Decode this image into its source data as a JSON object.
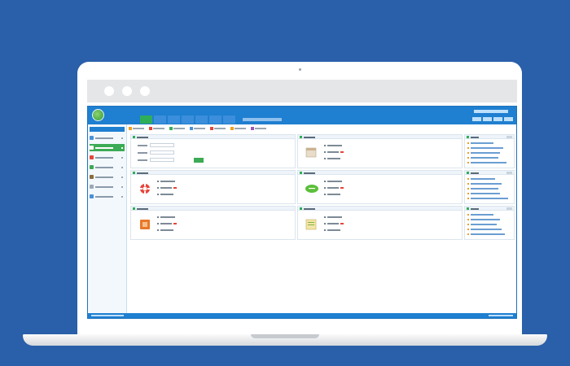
{
  "colors": {
    "background": "#2a5fa9",
    "header": "#1f7fd0",
    "active_green": "#3cab55",
    "alert_red": "#e4463a"
  },
  "app": {
    "title": "",
    "nav_tabs": [
      "",
      "",
      "",
      "",
      "",
      "",
      ""
    ],
    "active_tab_index": 0
  },
  "sidebar": {
    "heading": "",
    "items": [
      {
        "label": "",
        "icon": "home-icon"
      },
      {
        "label": "",
        "icon": "document-icon"
      },
      {
        "label": "",
        "icon": "user-icon"
      },
      {
        "label": "",
        "icon": "settings-icon"
      },
      {
        "label": "",
        "icon": "chart-icon"
      },
      {
        "label": "",
        "icon": "message-icon"
      },
      {
        "label": "",
        "icon": "grid-icon"
      }
    ],
    "active_index": 1
  },
  "dashboard": {
    "search_button": "",
    "panels": [
      {
        "title": "",
        "icon": "search-form-icon"
      },
      {
        "title": "",
        "icon": "calendar-icon"
      },
      {
        "title": "",
        "icon": "lifebuoy-icon"
      },
      {
        "title": "",
        "icon": "chat-bubble-icon"
      },
      {
        "title": "",
        "icon": "card-icon"
      },
      {
        "title": "",
        "icon": "notes-icon"
      }
    ],
    "news_panels": [
      {
        "title": "",
        "item_count": 5
      },
      {
        "title": "",
        "item_count": 5
      },
      {
        "title": "",
        "item_count": 5
      }
    ]
  }
}
